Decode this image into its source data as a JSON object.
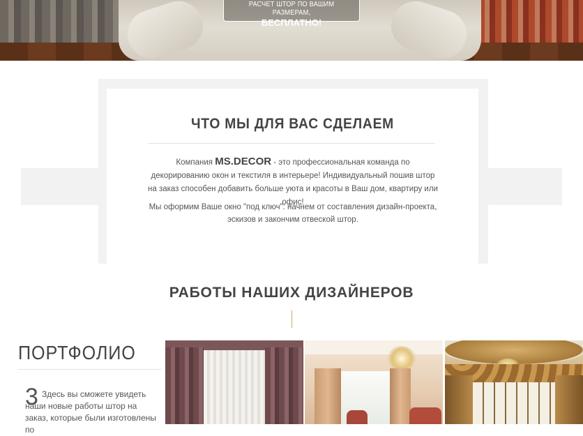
{
  "hero": {
    "cta_line1": "РАСЧЕТ ШТОР ПО ВАШИМ РАЗМЕРАМ,",
    "cta_line2": "БЕСПЛАТНО!"
  },
  "about": {
    "title": "ЧТО МЫ ДЛЯ ВАС СДЕЛАЕМ",
    "p1_prefix": "Компания ",
    "brand": "MS.DECOR",
    "p1_suffix": " - это профессиональная команда по декорированию окон и текстиля в интерьере! Индивидуальный пошив штор на заказ способен добавить больше уюта и красоты в Ваш дом, квартиру или офис!",
    "p2": "Мы оформим Ваше окно \"под ключ\": начнем от составления дизайн-проекта, эскизов и закончим отвеской штор."
  },
  "works": {
    "title": "РАБОТЫ НАШИХ ДИЗАЙНЕРОВ"
  },
  "portfolio": {
    "title": "ПОРТФОЛИО",
    "number": "3",
    "text": "Здесь вы сможете увидеть наши новые работы штор на заказ, которые были изготовлены по"
  },
  "colors": {
    "heading": "#444444",
    "body_text": "#555555",
    "accent": "#c7a574",
    "panel_bg": "#f2f2f2"
  }
}
